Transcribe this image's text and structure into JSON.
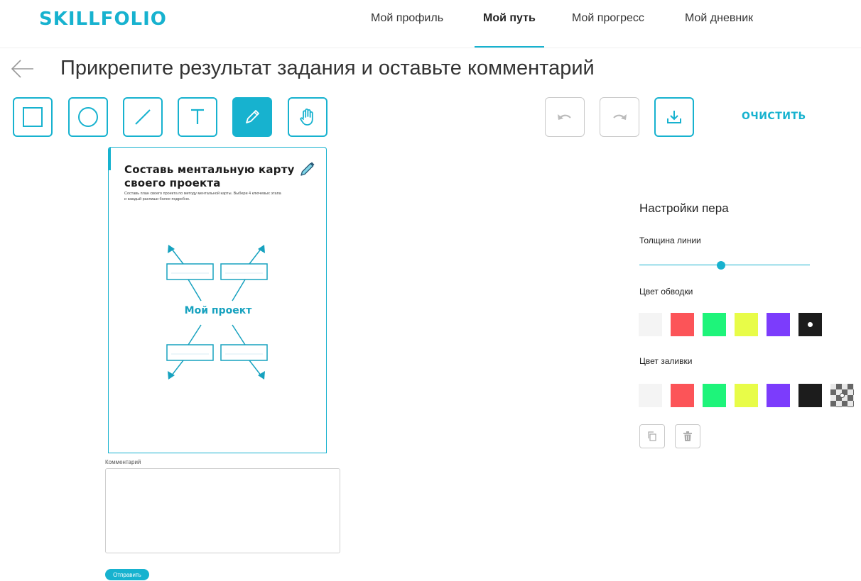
{
  "header": {
    "logo": "SKILLFOLIO",
    "nav": [
      {
        "label": "Мой профиль"
      },
      {
        "label": "Мой путь"
      },
      {
        "label": "Мой прогресс"
      },
      {
        "label": "Мой дневник"
      }
    ],
    "active_nav": "Мой путь"
  },
  "page": {
    "title": "Прикрепите результат задания и оставьте комментарий"
  },
  "toolbar": {
    "tools": [
      "rectangle-tool",
      "circle-tool",
      "line-tool",
      "text-tool",
      "pen-tool",
      "hand-tool"
    ],
    "active_tool": "pen-tool",
    "actions": [
      "undo",
      "redo",
      "download"
    ],
    "clear_label": "ОЧИСТИТЬ"
  },
  "card": {
    "title": "Составь ментальную карту своего проекта",
    "description": "Составь план своего проекта по методу ментальной карты. Выбери 4 ключевых этапа и каждый распиши более подробно.",
    "center_label": "Мой проект"
  },
  "comment": {
    "label": "Комментарий",
    "value": "",
    "placeholder": "",
    "submit_label": "Отправить"
  },
  "settings": {
    "title": "Настройки пера",
    "thickness_label": "Толщина линии",
    "thickness_value": 0.48,
    "stroke_label": "Цвет обводки",
    "fill_label": "Цвет заливки",
    "stroke_colors": [
      "#f4f4f4",
      "#fc5458",
      "#1ef47a",
      "#e8fc48",
      "#7c3cfc",
      "#1c1c1c"
    ],
    "stroke_selected": "#1c1c1c",
    "fill_colors": [
      "#f4f4f4",
      "#fc5458",
      "#1ef47a",
      "#e8fc48",
      "#7c3cfc",
      "#1c1c1c",
      "transparent"
    ],
    "fill_selected": "transparent"
  },
  "colors": {
    "accent": "#17b2cf"
  }
}
